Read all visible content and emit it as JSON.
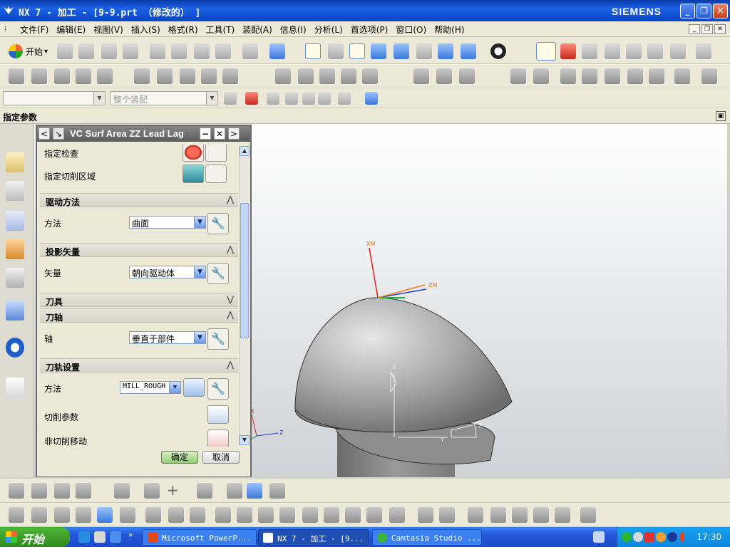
{
  "window": {
    "title": "NX 7 - 加工 - [9-9.prt （修改的） ]",
    "brand": "SIEMENS",
    "controls": [
      "_",
      "❐",
      "✕"
    ]
  },
  "menu": {
    "items": [
      "文件(F)",
      "编辑(E)",
      "视图(V)",
      "插入(S)",
      "格式(R)",
      "工具(T)",
      "装配(A)",
      "信息(I)",
      "分析(L)",
      "首选项(P)",
      "窗口(O)",
      "帮助(H)"
    ]
  },
  "toolbar": {
    "start_label": "开始",
    "start_arrow": "▾",
    "assembly_combo": "整个装配"
  },
  "status": {
    "prompt": "指定参数"
  },
  "dialog": {
    "title": "VC Surf Area ZZ Lead Lag",
    "nav_prev": "<",
    "nav_next": ">",
    "rows": {
      "check": "指定检查",
      "cut_area": "指定切削区域"
    },
    "groups": {
      "drive": {
        "header": "驱动方法",
        "method_label": "方法",
        "method_value": "曲面"
      },
      "projection": {
        "header": "投影矢量",
        "vector_label": "矢量",
        "vector_value": "朝向驱动体"
      },
      "tool": {
        "header": "刀具"
      },
      "axis": {
        "header": "刀轴",
        "axis_label": "轴",
        "axis_value": "垂直于部件"
      },
      "path": {
        "header": "刀轨设置",
        "method_label": "方法",
        "method_value": "MILL_ROUGH",
        "cut_params": "切削参数",
        "non_cut": "非切削移动"
      }
    },
    "ok": "确定",
    "cancel": "取消"
  },
  "viewport": {
    "axis_xm": "XM",
    "axis_zm": "ZM",
    "axis_x": "X",
    "axis_z": "Z",
    "axis_y": "Y",
    "tool_x": "X",
    "tool_z": "Z",
    "tool_y": "Y"
  },
  "taskbar": {
    "start": "开始",
    "items": [
      "Microsoft PowerP...",
      "NX 7 - 加工 - [9...",
      "Camtasia Studio ..."
    ],
    "clock": "17:30"
  },
  "colors": {
    "accent_blue": "#1c62e6",
    "ok_green": "#92cc74",
    "axis_red": "#e02020",
    "axis_blue": "#2040e0",
    "axis_orange": "#f08020"
  }
}
